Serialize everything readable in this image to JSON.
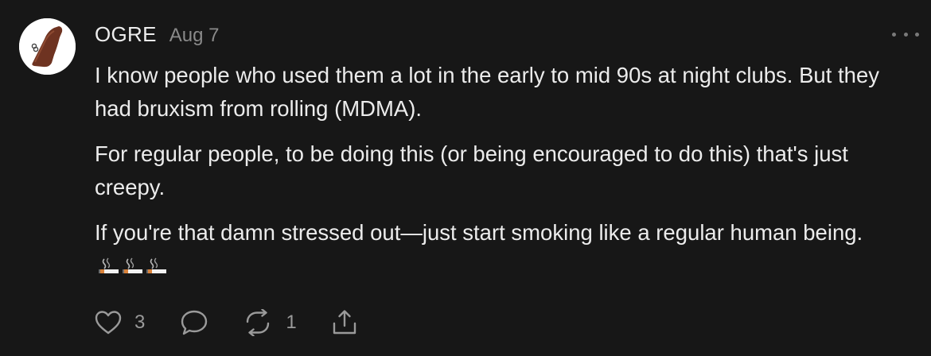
{
  "comment": {
    "avatar_icon": "ocarina-icon",
    "username": "OGRE",
    "date": "Aug 7",
    "more_icon": "ellipsis-icon",
    "paragraphs": [
      "I know people who used them a lot in the early to mid 90s at night clubs. But they had bruxism from rolling (MDMA).",
      "For regular people, to be doing this (or being encouraged to do this) that's just creepy.",
      "If you're that damn stressed out—just start smoking like a regular human being."
    ],
    "trailing_emoji": "cigarette-emoji",
    "trailing_emoji_count": 3,
    "actions": {
      "like_icon": "heart-icon",
      "like_count": "3",
      "reply_icon": "speech-bubble-icon",
      "restack_icon": "restack-icon",
      "restack_count": "1",
      "share_icon": "share-icon"
    }
  },
  "colors": {
    "background": "#171717",
    "text": "#ececec",
    "muted": "#8a8a8a",
    "icon": "#9a9a9a"
  }
}
